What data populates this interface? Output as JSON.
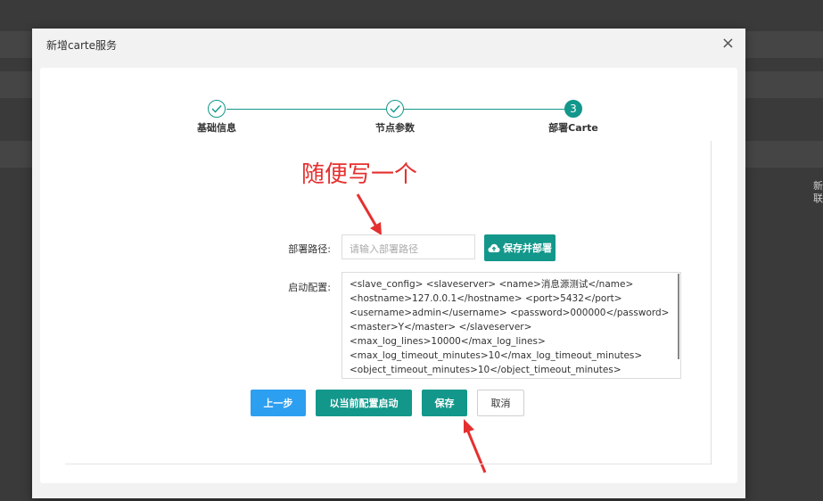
{
  "modal": {
    "title": "新增carte服务",
    "close": "×"
  },
  "steps": [
    {
      "label": "基础信息",
      "state": "done",
      "icon": "check-icon"
    },
    {
      "label": "节点参数",
      "state": "done",
      "icon": "check-icon"
    },
    {
      "label": "部署Carte",
      "state": "active",
      "number": "3"
    }
  ],
  "annotation": {
    "text": "随便写一个",
    "color": "#e53030"
  },
  "form": {
    "deploy_path_label": "部署路径:",
    "deploy_path_placeholder": "请输入部署路径",
    "save_deploy_button": "保存并部署",
    "start_config_label": "启动配置:",
    "start_config_lines": [
      "<slave_config> <slaveserver> <name>消息源测试</name>",
      "<hostname>127.0.0.1</hostname> <port>5432</port>",
      "<username>admin</username> <password>000000</password>",
      "<master>Y</master> </slaveserver>",
      "<max_log_lines>10000</max_log_lines>",
      "<max_log_timeout_minutes>10</max_log_timeout_minutes>",
      "<object_timeout_minutes>10</object_timeout_minutes>"
    ]
  },
  "buttons": {
    "prev": "上一步",
    "start_current": "以当前配置启动",
    "save": "保存",
    "cancel": "取消"
  },
  "background": {
    "side_text_1": "新",
    "side_text_2": "联"
  },
  "colors": {
    "accent": "#13978b",
    "blue": "#2d9ff0",
    "annotation": "#e53030"
  }
}
